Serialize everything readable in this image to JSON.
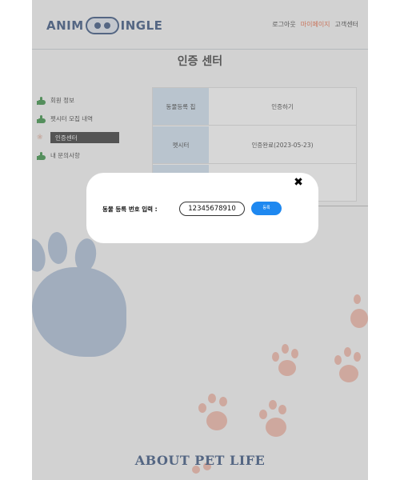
{
  "header": {
    "logo_left": "ANIM",
    "logo_right": "INGLE",
    "nav": [
      "로그아웃",
      "마이페이지",
      "고객센터"
    ]
  },
  "page_title": "인증 센터",
  "sidebar": {
    "items": [
      {
        "label": "회원 정보",
        "icon": "thumbs-up-icon"
      },
      {
        "label": "펫시터 모집 내역",
        "icon": "thumbs-up-icon"
      },
      {
        "label": "인증센터",
        "icon": "paw-icon",
        "active": true
      },
      {
        "label": "내 문의사항",
        "icon": "thumbs-up-icon"
      }
    ]
  },
  "cert_table": {
    "rows": [
      {
        "header": "동물등록 칩",
        "value": "인증하기"
      },
      {
        "header": "펫시터",
        "value": "인증완료(2023-05-23)"
      }
    ]
  },
  "modal": {
    "label": "동물 등록 번호 입력 :",
    "input_value": "12345678910",
    "button_label": "등록",
    "close_icon": "close-icon"
  },
  "footer_text": "ABOUT PET LIFE",
  "colors": {
    "accent": "#e8623a",
    "brand": "#2c4a78",
    "primary_button": "#1e88f0",
    "like_green": "#2e8b3a",
    "table_header": "#cfe0f0"
  }
}
